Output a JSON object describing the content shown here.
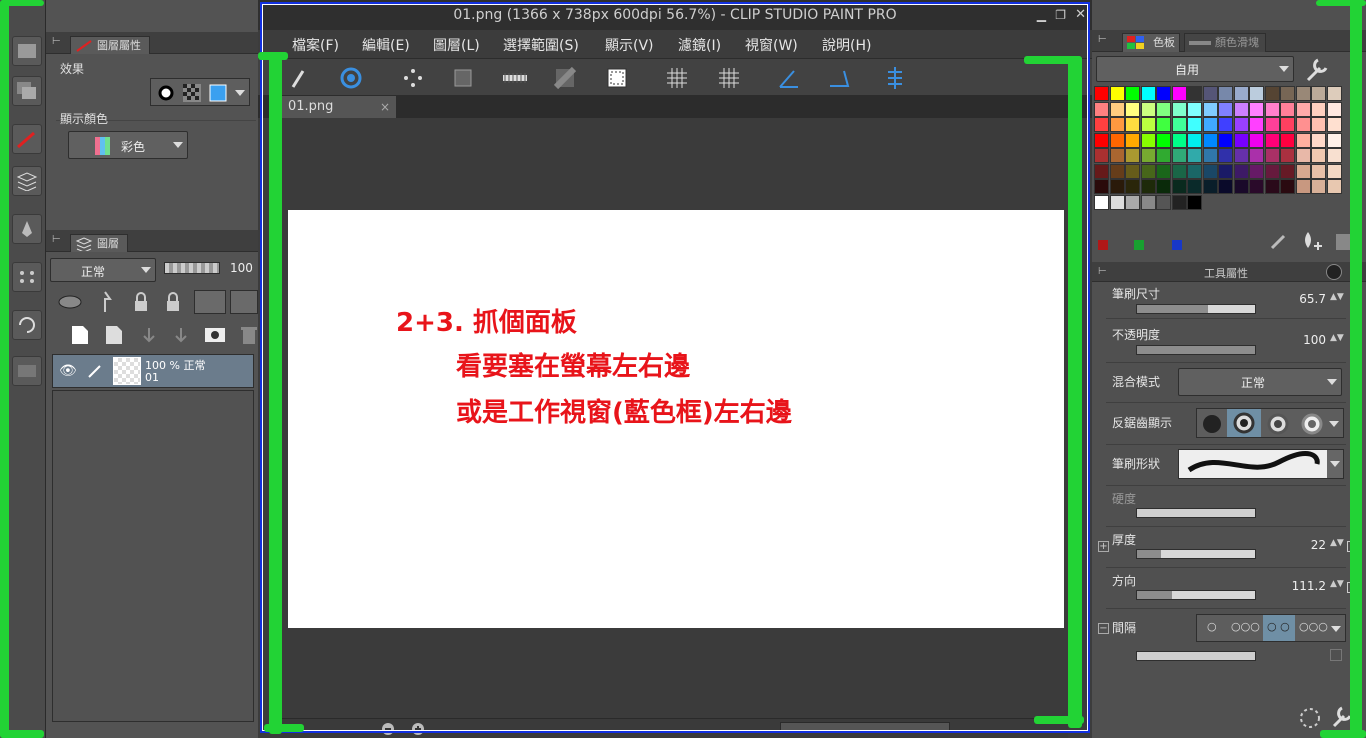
{
  "window": {
    "title": "01.png (1366 x 738px 600dpi 56.7%)  - CLIP STUDIO PAINT PRO",
    "min_glyph": "▁",
    "max_glyph": "❐",
    "close_glyph": "✕"
  },
  "menu": [
    "檔案(F)",
    "編輯(E)",
    "圖層(L)",
    "選擇範圍(S)",
    "顯示(V)",
    "濾鏡(I)",
    "視窗(W)",
    "說明(H)"
  ],
  "document_tab": {
    "name": "01.png",
    "close": "×"
  },
  "annotation": {
    "line1": "2+3. 抓個面板",
    "line2": "看要塞在螢幕左右邊",
    "line3": "或是工作視窗(藍色框)左右邊",
    "color": "#e8141a"
  },
  "layer_property": {
    "tab_label": "圖層屬性",
    "effect_label": "效果",
    "display_color_label": "顯示顏色",
    "display_color_value": "彩色"
  },
  "layer_panel": {
    "tab_label": "圖層",
    "blend_mode": "正常",
    "opacity": "100",
    "layer": {
      "opacity_mode": "100 % 正常",
      "name": "01"
    }
  },
  "color_set": {
    "tab1_label": "色板",
    "tab2_label": "顏色滑塊",
    "set_name": "自用"
  },
  "tool_property": {
    "header": "工具屬性",
    "brush_size_label": "筆刷尺寸",
    "brush_size_value": "65.7",
    "brush_size_level": 0.6,
    "opacity_label": "不透明度",
    "opacity_value": "100",
    "opacity_level": 1.0,
    "blend_label": "混合模式",
    "blend_value": "正常",
    "antialias_label": "反鋸齒顯示",
    "brush_shape_label": "筆刷形狀",
    "hardness_label": "硬度",
    "thickness_label": "厚度",
    "thickness_value": "22",
    "thickness_level": 0.2,
    "direction_label": "方向",
    "direction_value": "111.2",
    "direction_level": 0.3,
    "interval_label": "間隔"
  },
  "accent_colors": {
    "highlight_green": "#22d335",
    "frame_blue": "#1230e0"
  }
}
